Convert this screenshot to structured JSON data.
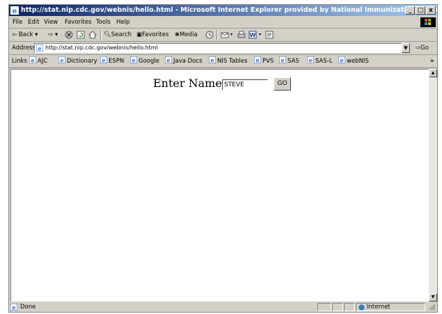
{
  "window": {
    "title": "http://stat.nip.cdc.gov/webnis/hello.html - Microsoft Internet Explorer provided by National Immunization Program",
    "controls": {
      "minimize": "_",
      "maximize": "□",
      "close": "x"
    }
  },
  "menu": {
    "items": [
      {
        "label": "File"
      },
      {
        "label": "Edit"
      },
      {
        "label": "View"
      },
      {
        "label": "Favorites"
      },
      {
        "label": "Tools"
      },
      {
        "label": "Help"
      }
    ]
  },
  "toolbar": {
    "back": "Back",
    "search": "Search",
    "favorites": "Favorites",
    "media": "Media"
  },
  "address": {
    "label": "Address",
    "url": "http://stat.nip.cdc.gov/webnis/hello.html",
    "go": "Go"
  },
  "links": {
    "label": "Links",
    "items": [
      {
        "label": "AJC"
      },
      {
        "label": "Dictionary"
      },
      {
        "label": "ESPN"
      },
      {
        "label": "Google"
      },
      {
        "label": "Java Docs"
      },
      {
        "label": "NIS Tables"
      },
      {
        "label": "PVS"
      },
      {
        "label": "SAS"
      },
      {
        "label": "SAS-L"
      },
      {
        "label": "webNIS"
      }
    ],
    "more": "»"
  },
  "page": {
    "label": "Enter Name:",
    "input_value": "STEVE",
    "button": "GO"
  },
  "status": {
    "text": "Done",
    "zone": "Internet"
  },
  "colors": {
    "title_start": "#0a246a",
    "title_end": "#a6caf0",
    "chrome": "#d4d0c8",
    "ie_blue": "#1f5fbf"
  }
}
